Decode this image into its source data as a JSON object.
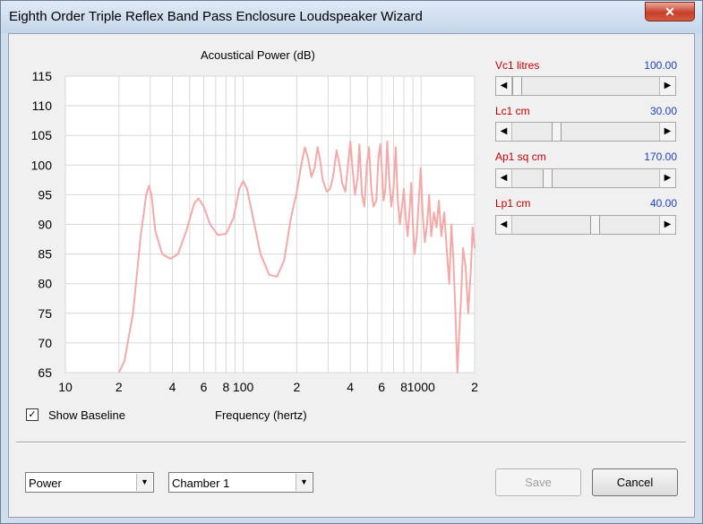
{
  "window": {
    "title": "Eighth Order Triple Reflex Band Pass Enclosure Loudspeaker Wizard",
    "close_glyph": "✕"
  },
  "sliders": [
    {
      "label": "Vc1  litres",
      "value": "100.00",
      "position": 0.0
    },
    {
      "label": "Lc1  cm",
      "value": "30.00",
      "position": 0.29
    },
    {
      "label": "Ap1  sq cm",
      "value": "170.00",
      "position": 0.22
    },
    {
      "label": "Lp1  cm",
      "value": "40.00",
      "position": 0.57
    }
  ],
  "show_baseline": {
    "label": "Show Baseline",
    "checked": true,
    "glyph": "✓"
  },
  "combos": {
    "mode": {
      "value": "Power"
    },
    "chamber": {
      "value": "Chamber 1"
    }
  },
  "buttons": {
    "save": "Save",
    "cancel": "Cancel"
  },
  "icons": {
    "arrow_left": "◀",
    "arrow_right": "▶",
    "arrow_down": "▼"
  },
  "colors": {
    "curve": "#f4a8a8",
    "grid": "#d8d8d8",
    "value_text": "#1f3fbf",
    "label_text": "#c00000"
  },
  "chart_data": {
    "type": "line",
    "title": "Acoustical Power (dB)",
    "xlabel": "Frequency (hertz)",
    "ylabel": "",
    "x_scale": "log",
    "xlim": [
      10,
      2000
    ],
    "ylim": [
      65,
      115
    ],
    "x_ticks": [
      {
        "value": 10,
        "label": "10"
      },
      {
        "value": 20,
        "label": "2"
      },
      {
        "value": 40,
        "label": "4"
      },
      {
        "value": 60,
        "label": "6"
      },
      {
        "value": 80,
        "label": "8"
      },
      {
        "value": 100,
        "label": "100"
      },
      {
        "value": 200,
        "label": "2"
      },
      {
        "value": 400,
        "label": "4"
      },
      {
        "value": 600,
        "label": "6"
      },
      {
        "value": 800,
        "label": "8"
      },
      {
        "value": 1000,
        "label": "1000"
      },
      {
        "value": 2000,
        "label": "2"
      }
    ],
    "y_ticks": [
      65,
      70,
      75,
      80,
      85,
      90,
      95,
      100,
      105,
      110,
      115
    ],
    "grid": true,
    "series": [
      {
        "points": [
          [
            20,
            65
          ],
          [
            21.5,
            67
          ],
          [
            24,
            75
          ],
          [
            26.5,
            88
          ],
          [
            28.5,
            95
          ],
          [
            29.5,
            96.5
          ],
          [
            30.5,
            95
          ],
          [
            32,
            89
          ],
          [
            35,
            85
          ],
          [
            39,
            84.2
          ],
          [
            43,
            85
          ],
          [
            48,
            89
          ],
          [
            53,
            93.5
          ],
          [
            56,
            94.4
          ],
          [
            60,
            93
          ],
          [
            65,
            90
          ],
          [
            72,
            88.2
          ],
          [
            80,
            88.4
          ],
          [
            88,
            91
          ],
          [
            95,
            96
          ],
          [
            100,
            97.3
          ],
          [
            105,
            96
          ],
          [
            112,
            92
          ],
          [
            125,
            85
          ],
          [
            140,
            81.5
          ],
          [
            155,
            81.2
          ],
          [
            170,
            84
          ],
          [
            185,
            91
          ],
          [
            200,
            95.5
          ],
          [
            212,
            100
          ],
          [
            222,
            103
          ],
          [
            232,
            101
          ],
          [
            242,
            98
          ],
          [
            252,
            99.5
          ],
          [
            262,
            103
          ],
          [
            270,
            101
          ],
          [
            280,
            97.5
          ],
          [
            295,
            95.5
          ],
          [
            308,
            96
          ],
          [
            320,
            98
          ],
          [
            335,
            102.5
          ],
          [
            348,
            100
          ],
          [
            360,
            97
          ],
          [
            375,
            95.5
          ],
          [
            388,
            100
          ],
          [
            400,
            104
          ],
          [
            410,
            100
          ],
          [
            425,
            95
          ],
          [
            440,
            98
          ],
          [
            450,
            103.5
          ],
          [
            465,
            95
          ],
          [
            480,
            93
          ],
          [
            495,
            100
          ],
          [
            510,
            103
          ],
          [
            525,
            96
          ],
          [
            540,
            93
          ],
          [
            560,
            94
          ],
          [
            575,
            101
          ],
          [
            590,
            103.5
          ],
          [
            605,
            98
          ],
          [
            615,
            94
          ],
          [
            630,
            96
          ],
          [
            645,
            104
          ],
          [
            660,
            98
          ],
          [
            680,
            93
          ],
          [
            700,
            96
          ],
          [
            720,
            103
          ],
          [
            740,
            94
          ],
          [
            760,
            90
          ],
          [
            780,
            93
          ],
          [
            800,
            96
          ],
          [
            820,
            91
          ],
          [
            840,
            88
          ],
          [
            860,
            92
          ],
          [
            880,
            97
          ],
          [
            900,
            90
          ],
          [
            920,
            85
          ],
          [
            945,
            88
          ],
          [
            970,
            94
          ],
          [
            995,
            99.5
          ],
          [
            1020,
            92
          ],
          [
            1050,
            87
          ],
          [
            1080,
            90
          ],
          [
            1110,
            95
          ],
          [
            1140,
            88
          ],
          [
            1180,
            92
          ],
          [
            1220,
            89.5
          ],
          [
            1260,
            94
          ],
          [
            1300,
            88
          ],
          [
            1350,
            92
          ],
          [
            1400,
            85
          ],
          [
            1440,
            80
          ],
          [
            1480,
            90
          ],
          [
            1520,
            84
          ],
          [
            1560,
            75
          ],
          [
            1600,
            65
          ],
          [
            1640,
            72
          ],
          [
            1680,
            78
          ],
          [
            1720,
            86
          ],
          [
            1780,
            83
          ],
          [
            1840,
            75
          ],
          [
            1900,
            82
          ],
          [
            1950,
            89.5
          ],
          [
            2000,
            86
          ]
        ]
      }
    ]
  }
}
